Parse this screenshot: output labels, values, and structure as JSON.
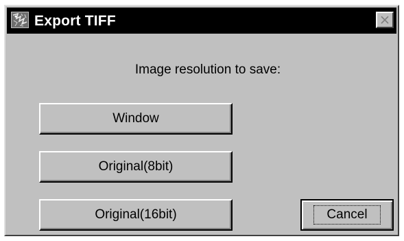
{
  "window": {
    "title": "Export TIFF",
    "app_icon": "tiff-export-icon",
    "close_icon": "close-icon"
  },
  "prompt": "Image resolution to save:",
  "buttons": {
    "window": "Window",
    "original_8bit": "Original(8bit)",
    "original_16bit": "Original(16bit)",
    "cancel": "Cancel"
  },
  "colors": {
    "face": "#c0c0c0",
    "titlebar": "#000000",
    "title_text": "#ffffff"
  }
}
